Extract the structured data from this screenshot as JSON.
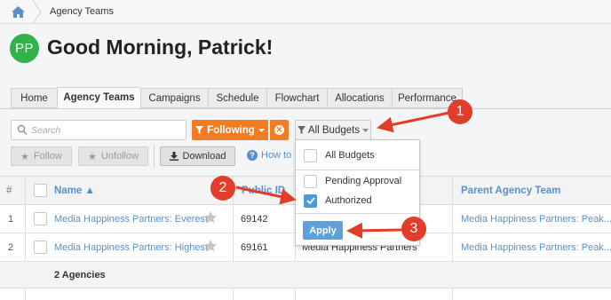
{
  "breadcrumb": {
    "home_icon": "home-icon",
    "current": "Agency Teams"
  },
  "user": {
    "initials": "PP",
    "greeting": "Good Morning, Patrick!",
    "avatar_color": "#31b24a"
  },
  "tabs": [
    {
      "label": "Home",
      "active": false
    },
    {
      "label": "Agency Teams",
      "active": true
    },
    {
      "label": "Campaigns",
      "active": false
    },
    {
      "label": "Schedule",
      "active": false
    },
    {
      "label": "Flowchart",
      "active": false
    },
    {
      "label": "Allocations",
      "active": false
    },
    {
      "label": "Performance",
      "active": false
    }
  ],
  "toolbar": {
    "search_placeholder": "Search",
    "following_label": "Following",
    "budgets_label": "All Budgets",
    "follow_label": "Follow",
    "unfollow_label": "Unfollow",
    "download_label": "Download",
    "howto_label": "How to M"
  },
  "table": {
    "headers": {
      "num": "#",
      "name": "Name ▲",
      "public_id": "Public ID",
      "parent": "Parent Agency Team"
    },
    "rows": [
      {
        "num": "1",
        "name": "Media Happiness Partners: Everest",
        "id": "69142",
        "parent": "Media Happiness Partners: Peak..."
      },
      {
        "num": "2",
        "name": "Media Happiness Partners: Highest",
        "id": "69161",
        "agency": "Media Happiness Partners",
        "parent": "Media Happiness Partners: Peak..."
      }
    ],
    "footer": "2 Agencies"
  },
  "budget_dropdown": {
    "options": [
      {
        "label": "All Budgets",
        "checked": false
      },
      {
        "label": "Pending Approval",
        "checked": false
      },
      {
        "label": "Authorized",
        "checked": true
      }
    ],
    "apply_label": "Apply"
  },
  "callouts": [
    "1",
    "2",
    "3"
  ],
  "colors": {
    "accent_orange": "#f27c21",
    "link_blue": "#5b8fc9",
    "apply_blue": "#5fa0d8",
    "callout_red": "#e03e2a"
  }
}
